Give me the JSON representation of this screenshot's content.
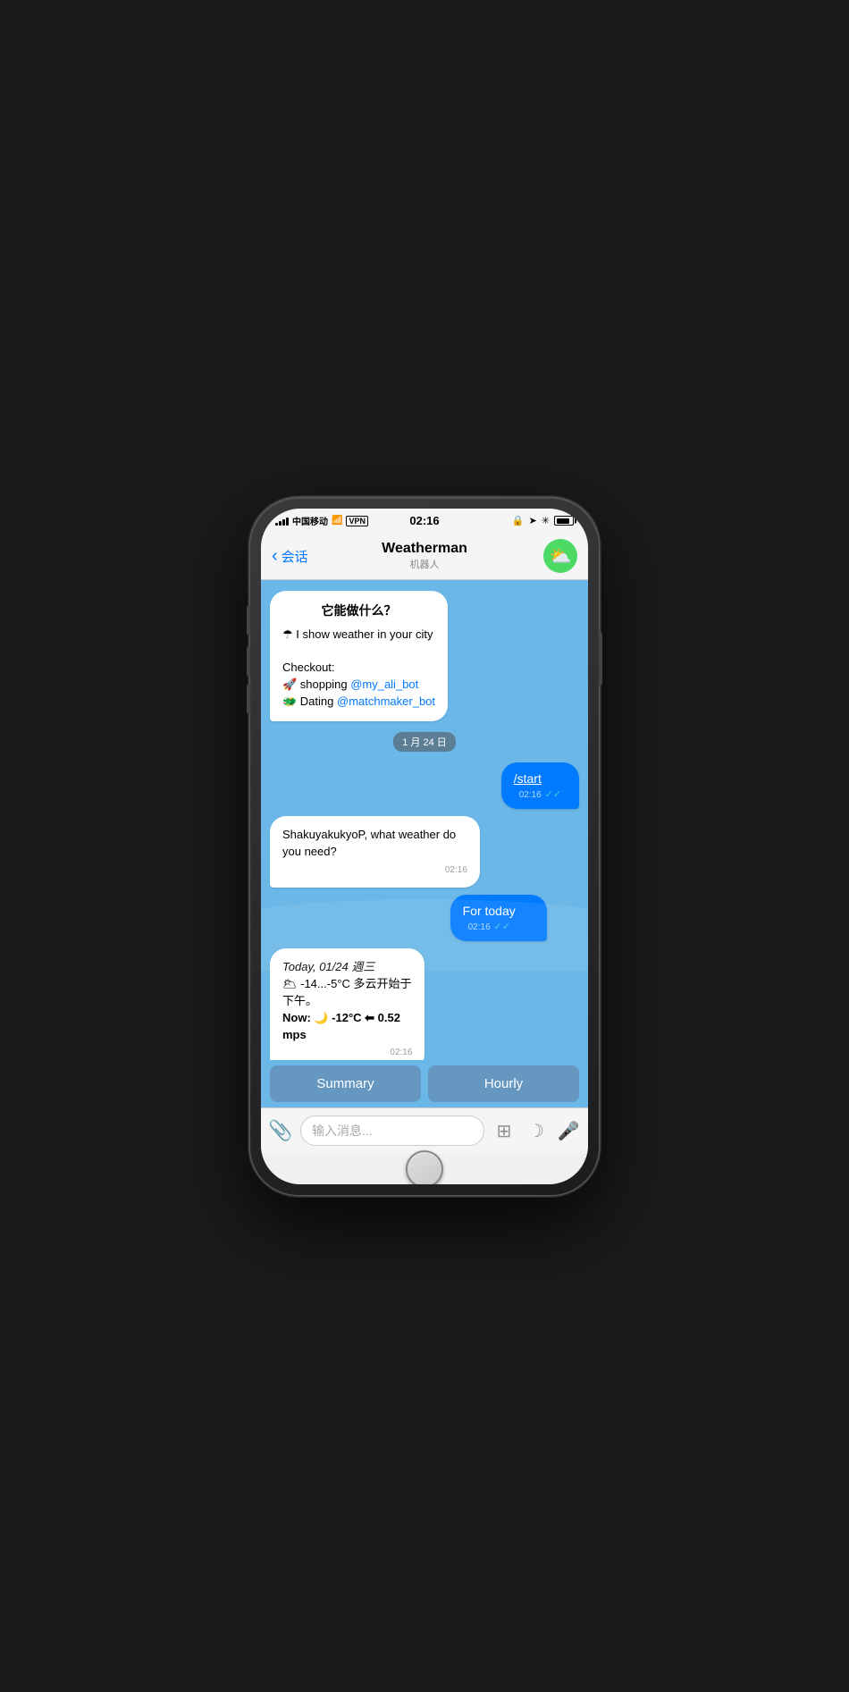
{
  "phone": {
    "status_bar": {
      "carrier": "中国移动",
      "wifi": "WiFi",
      "vpn": "VPN",
      "time": "02:16",
      "battery": "85"
    },
    "nav": {
      "back_label": "会话",
      "title": "Weatherman",
      "subtitle": "机器人",
      "icon": "⛅"
    },
    "messages": [
      {
        "id": "msg1",
        "type": "left",
        "content_type": "intro",
        "heading": "它能做什么？",
        "lines": [
          "☂ I show weather in your city",
          "",
          "Checkout:",
          "🚀 shopping @my_ali_bot",
          "🐲 Dating @matchmaker_bot"
        ]
      },
      {
        "id": "date1",
        "type": "date",
        "text": "1 月 24 日"
      },
      {
        "id": "msg2",
        "type": "right",
        "text": "/start",
        "time": "02:16",
        "read": true
      },
      {
        "id": "msg3",
        "type": "left",
        "text": "ShakuyakukyoP, what weather do you need?",
        "time": "02:16"
      },
      {
        "id": "msg4",
        "type": "right",
        "text": "For today",
        "time": "02:16",
        "read": true
      },
      {
        "id": "msg5",
        "type": "left",
        "content_type": "weather",
        "date_line": "Today, 01/24 週三",
        "temp_line": "🌥 -14...-5°C 多云开始于下午。",
        "now_line": "Now: 🌙 -12°C ⬅ 0.52 mps",
        "time": "02:16"
      }
    ],
    "quick_replies": {
      "summary": "Summary",
      "hourly": "Hourly"
    },
    "input": {
      "placeholder": "输入消息...",
      "attachment_icon": "📎",
      "sticker_icon": "⊞",
      "moon_icon": "☽",
      "mic_icon": "🎤"
    }
  }
}
